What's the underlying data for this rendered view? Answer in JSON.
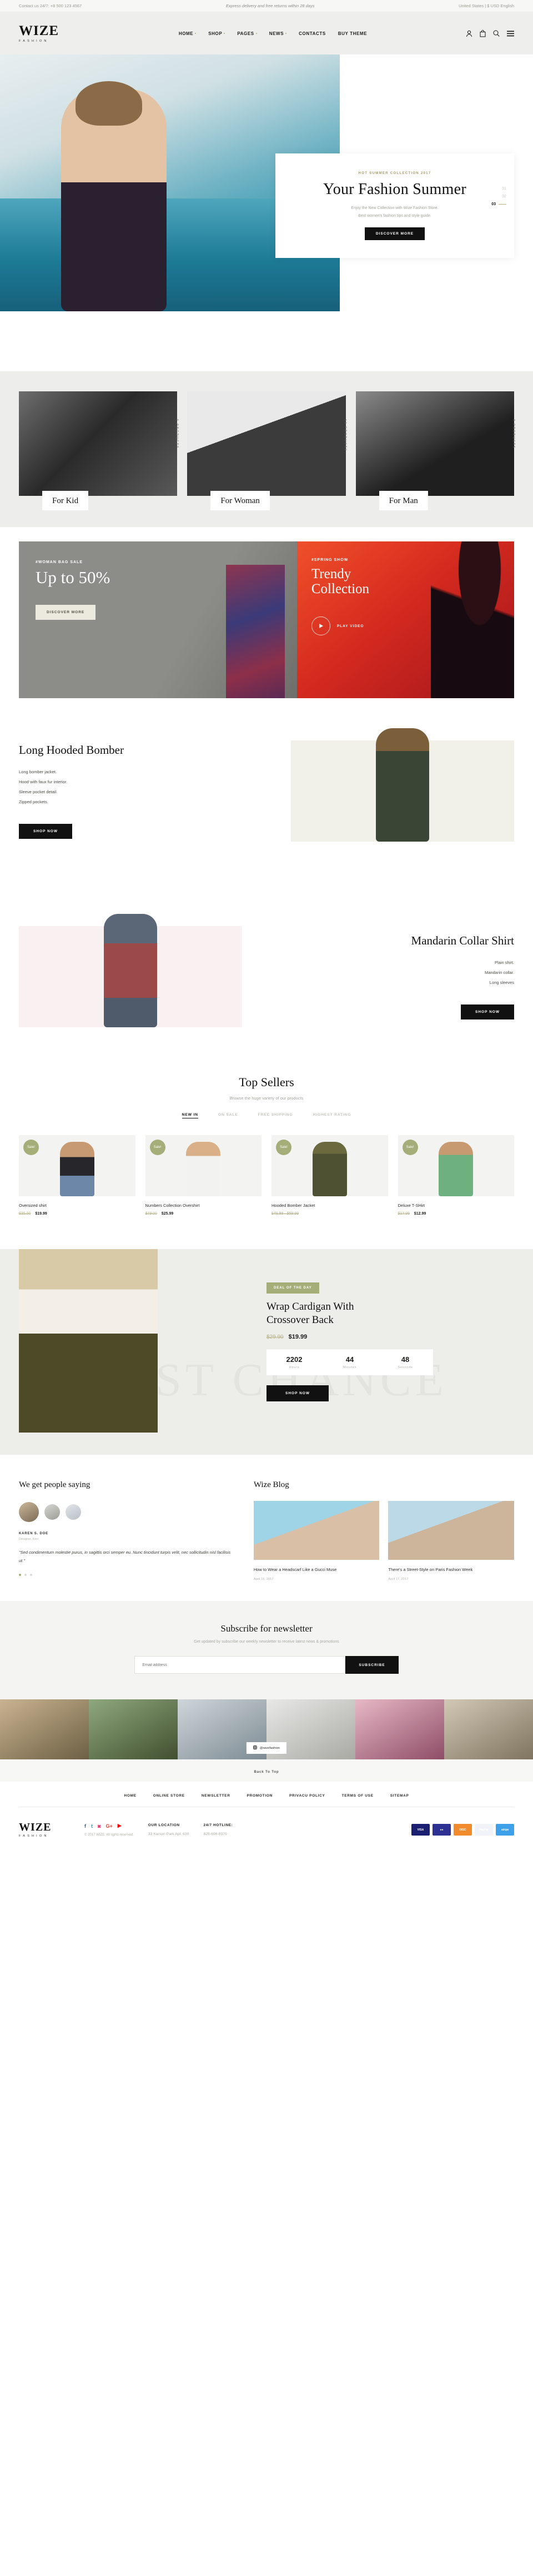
{
  "topbar": {
    "contact": "Contact us 24/7: +8 500 123 4567",
    "shipping": "Express delivery and free returns within 28 days",
    "locale": "United States | $ USD English"
  },
  "header": {
    "logo_word": "WIZE",
    "logo_sub": "FASHION",
    "nav": [
      {
        "label": "HOME",
        "has_dot": true
      },
      {
        "label": "SHOP",
        "has_dot": true
      },
      {
        "label": "PAGES",
        "has_dot": true
      },
      {
        "label": "NEWS",
        "has_dot": true
      },
      {
        "label": "CONTACTS",
        "has_dot": false
      },
      {
        "label": "BUY THEME",
        "has_dot": false
      }
    ],
    "icons": [
      "account-icon",
      "cart-icon",
      "search-icon",
      "menu-icon"
    ]
  },
  "hero": {
    "eyebrow": "HOT SUMMER COLLECTION 2017",
    "title": "Your Fashion Summer",
    "subtitle_line1": "Enjoy the New Collection with Wize Fashion Store.",
    "subtitle_line2": "Best women's fashion tips and style guide.",
    "button": "DISCOVER MORE",
    "pager": [
      "01",
      "02",
      "03"
    ],
    "pager_active": "03"
  },
  "categories": [
    {
      "label": "For Kid",
      "count": "5 PRODUCTS"
    },
    {
      "label": "For Woman",
      "count": "13 PRODUCTS"
    },
    {
      "label": "For Man",
      "count": "3 PRODUCTS"
    }
  ],
  "promo": {
    "left": {
      "tag": "#WOMAN BAG SALE",
      "heading": "Up to 50%",
      "button": "DISCOVER MORE"
    },
    "right": {
      "tag": "#SPRING SHOW",
      "heading_line1": "Trendy",
      "heading_line2": "Collection",
      "play_label": "PLAY VIDEO"
    }
  },
  "features": [
    {
      "title": "Long Hooded Bomber",
      "bullets": [
        "Long bomber jacket.",
        "Hood with faux fur interior.",
        "Sleeve pocket detail.",
        "Zipped pockets."
      ],
      "button": "SHOP NOW"
    },
    {
      "title": "Mandarin Collar Shirt",
      "bullets": [
        "Plain shirt.",
        "Mandarin collar.",
        "Long sleeves"
      ],
      "button": "SHOP NOW"
    }
  ],
  "sellers": {
    "title": "Top Sellers",
    "subtitle": "Browse the huge variety of our products",
    "filters": [
      "NEW IN",
      "ON SALE",
      "FREE SHIPPING",
      "HIGHEST RATING"
    ],
    "filter_active": "NEW IN",
    "badge": "Sale!",
    "products": [
      {
        "name": "Oversized shirt",
        "old_price": "$35.00",
        "new_price": "$19.99",
        "badge": true
      },
      {
        "name": "Numbers Collection Overshirt",
        "old_price": "$79.00",
        "new_price": "$25.99",
        "badge": true
      },
      {
        "name": "Hooded Bomber Jacket",
        "old_price": "$49.99 - $59.99",
        "new_price": "",
        "badge": true
      },
      {
        "name": "Deluxe T-SHirt",
        "old_price": "$17.99",
        "new_price": "$12.99",
        "badge": true
      }
    ]
  },
  "deal": {
    "watermark": "LAST CHANCE",
    "badge": "DEAL OF THE DAY",
    "title_line1": "Wrap Cardigan With",
    "title_line2": "Crossover Back",
    "old_price": "$29.90",
    "new_price": "$19.99",
    "counter": [
      {
        "num": "2202",
        "label": "Hours"
      },
      {
        "num": "44",
        "label": "Minutes"
      },
      {
        "num": "48",
        "label": "Seconds"
      }
    ],
    "button": "SHOP NOW"
  },
  "testimonials": {
    "title": "We get people saying",
    "name": "KAREN S. DOE",
    "role": "Designer, Kiev",
    "quote": "\"Sed condimentum molestie purus, in sagittis orci semper eu. Nunc tincidunt turpis velit, nec sollicitudin nisl facilisis ut.\""
  },
  "blog": {
    "title": "Wize Blog",
    "posts": [
      {
        "title": "How to Wear a Headscarf Like a Gucci Muse",
        "date": "April 16, 2017"
      },
      {
        "title": "There's a Street-Style on Paris Fashion Week",
        "date": "April 17, 2017"
      }
    ]
  },
  "newsletter": {
    "title": "Subscribe for newsletter",
    "subtitle": "Get updated by subscribe our weekly newsletter to receive latest news & promotions",
    "placeholder": "Email address",
    "button": "SUBSCRIBE"
  },
  "instagram": {
    "button": "@wizefashion"
  },
  "backtop": "Back To Top",
  "footer": {
    "nav": [
      "HOME",
      "ONLINE STORE",
      "NEWSLETTER",
      "PROMOTION",
      "PRIVACU POLICY",
      "TERMS OF USE",
      "SITEMAP"
    ],
    "logo_word": "WIZE",
    "logo_sub": "FASHION",
    "social": [
      "facebook-icon",
      "twitter-icon",
      "instagram-icon",
      "google-plus-icon",
      "youtube-icon"
    ],
    "copyright": "© 2017 WIZE. All rights reserved.",
    "location_label": "OUR LOCATION",
    "location_value": "33 Karson Park Apt. 630",
    "hotline_label": "24/7 HOTLINE:",
    "hotline_value": "828-696-8370",
    "payments": [
      "VISA",
      "MC",
      "DISCOVER",
      "PayPal",
      "stripe"
    ]
  }
}
